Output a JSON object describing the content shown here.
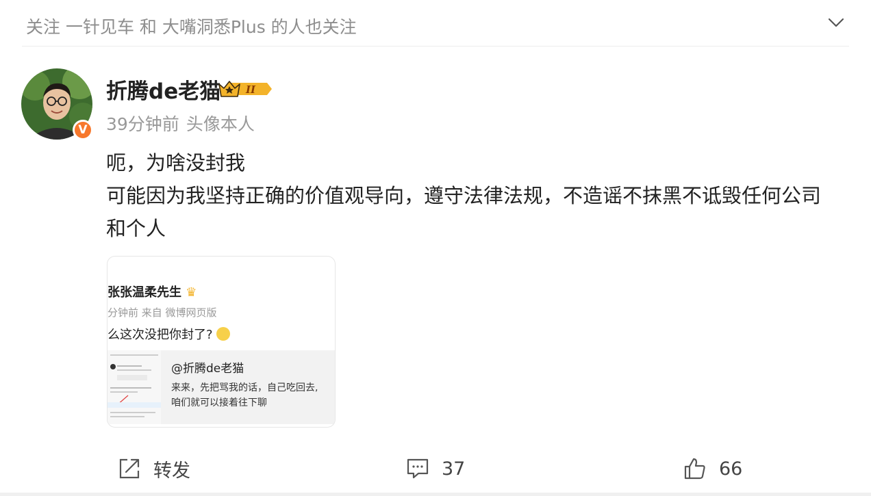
{
  "header": {
    "follow_hint": "关注 一针见车 和 大嘴洞悉Plus 的人也关注"
  },
  "post": {
    "author": "折腾de老猫",
    "member_level": "II",
    "verified_mark": "V",
    "time": "39分钟前",
    "source": "头像本人",
    "text_lines": [
      "呃，为啥没封我",
      "可能因为我坚持正确的价值观导向，遵守法律法规，不造谣不抹黑不诋毁任何公司",
      "和个人"
    ]
  },
  "thumbnail": {
    "name": "张张温柔先生",
    "meta": "分钟前  来自 微博网页版",
    "text": "么这次没把你封了?",
    "quote_at": "@折腾de老猫",
    "quote_line1": "来来，先把骂我的话，自己吃回去,",
    "quote_line2": "咱们就可以接着往下聊"
  },
  "actions": {
    "repost_label": "转发",
    "comment_count": "37",
    "like_count": "66"
  },
  "colors": {
    "badge_orange": "#f7782c",
    "gold": "#f3b32a",
    "muted_text": "#999999"
  }
}
